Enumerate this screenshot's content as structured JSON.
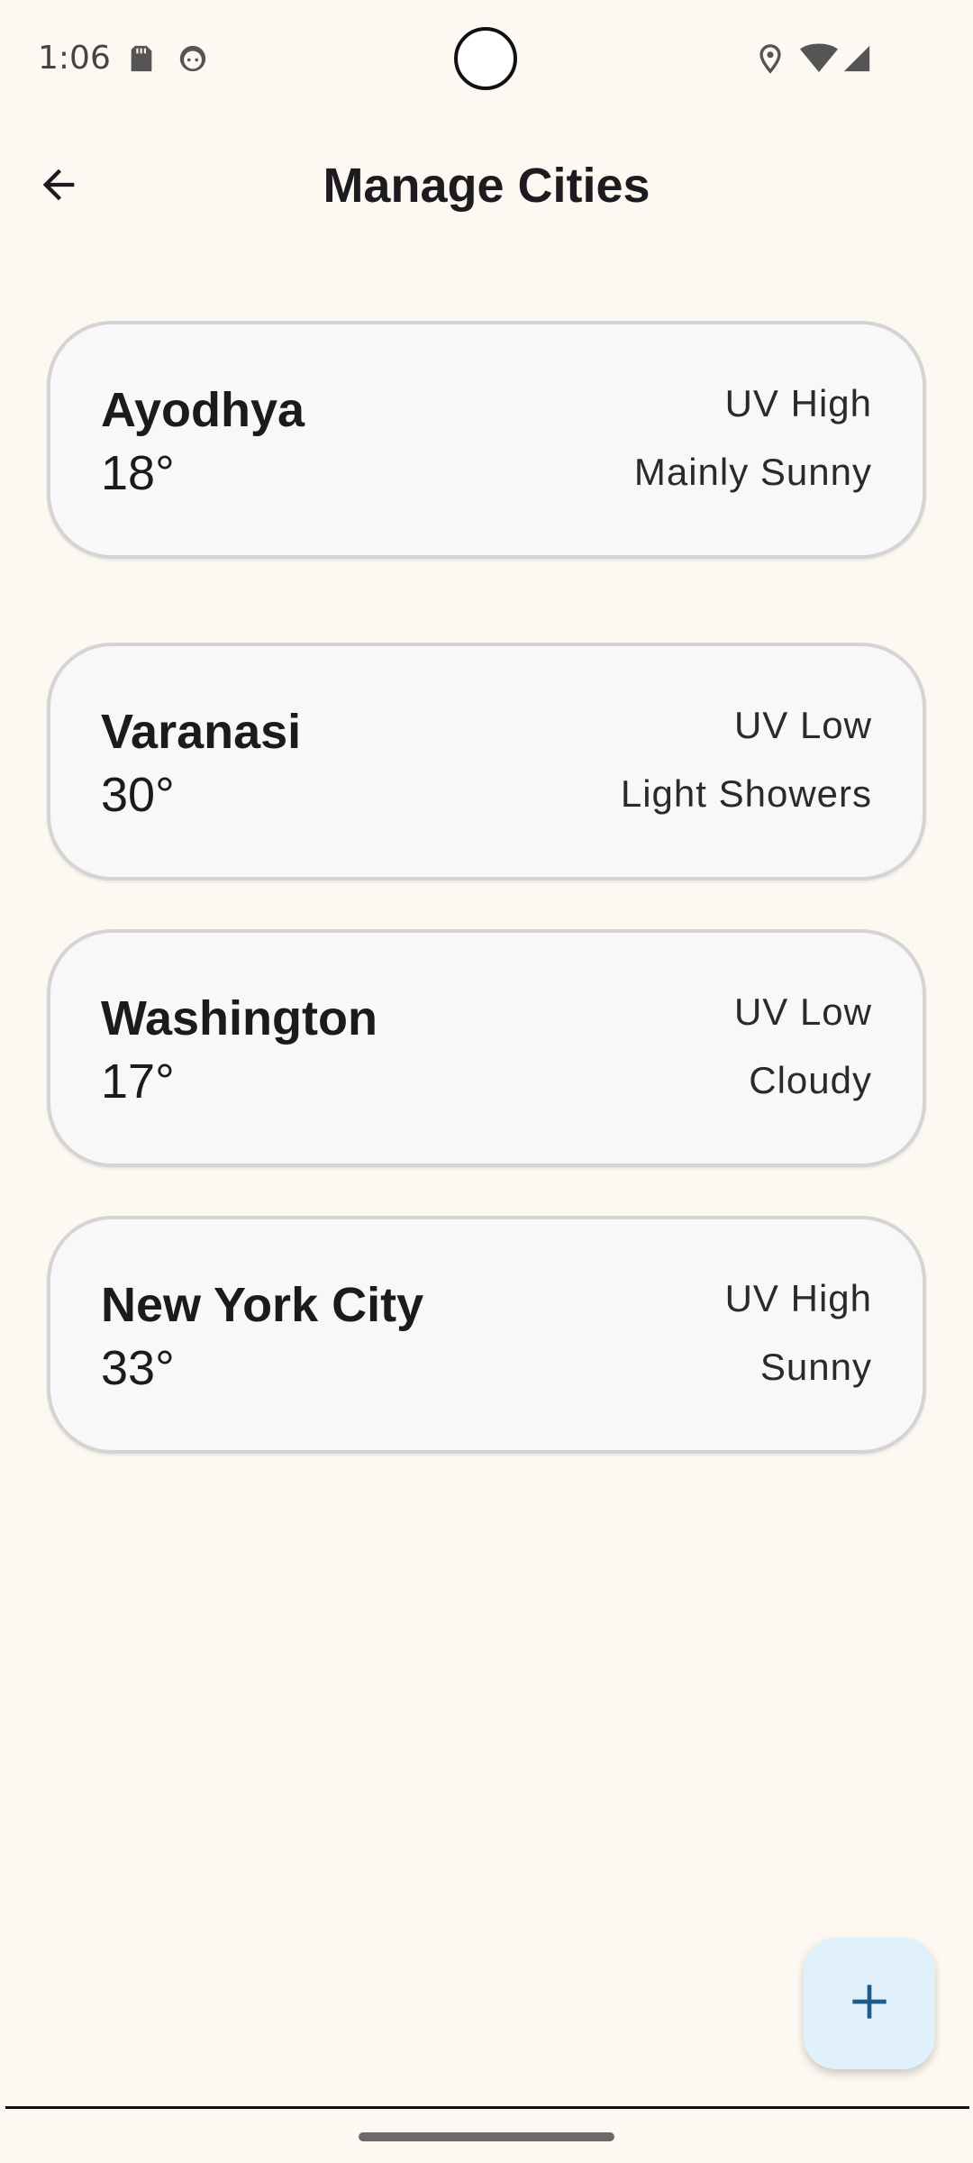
{
  "status_bar": {
    "time": "1:06",
    "icons": [
      "sd-card-icon",
      "face-icon",
      "location-icon",
      "wifi-icon",
      "cell-signal-icon"
    ]
  },
  "app_bar": {
    "title": "Manage Cities",
    "back_icon": "arrow-back-icon"
  },
  "cities": [
    {
      "name": "Ayodhya",
      "temp": "18°",
      "uv": "UV High",
      "condition": "Mainly Sunny"
    },
    {
      "name": "Varanasi",
      "temp": "30°",
      "uv": "UV Low",
      "condition": "Light Showers"
    },
    {
      "name": "Washington",
      "temp": "17°",
      "uv": "UV Low",
      "condition": "Cloudy"
    },
    {
      "name": "New York City",
      "temp": "33°",
      "uv": "UV High",
      "condition": "Sunny"
    }
  ],
  "fab": {
    "icon": "add-icon"
  },
  "colors": {
    "background": "#fdf9f2",
    "card": "#f8f8f8",
    "card_border": "#d4d4d4",
    "fab": "#e1f1fb",
    "fab_icon": "#1e5a8a"
  }
}
